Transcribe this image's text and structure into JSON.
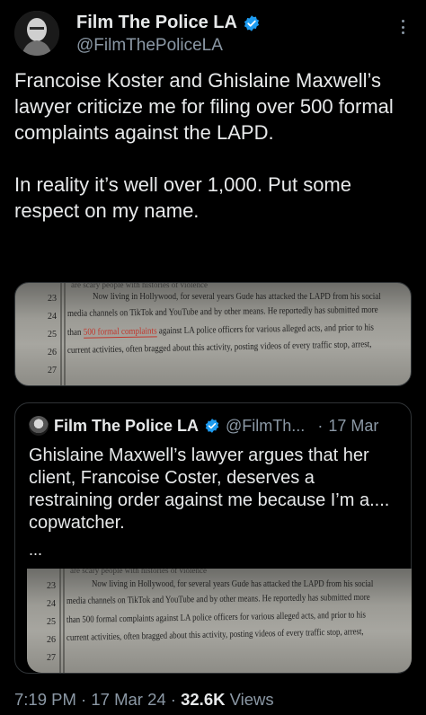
{
  "author": {
    "display_name": "Film The Police LA",
    "handle": "@FilmThePoliceLA"
  },
  "tweet": {
    "text": "Francoise Koster and Ghislaine Maxwell’s lawyer criticize me for filing over 500 formal complaints against the LAPD.\n\nIn reality it’s well over 1,000. Put some respect on my name."
  },
  "document_image": {
    "top_cut_text": "are scary people with histories of violence",
    "line_numbers": [
      "23",
      "24",
      "25",
      "26",
      "27"
    ],
    "lines": [
      "Now living in Hollywood, for several years Gude has attacked the LAPD from his social",
      "media channels on TikTok and YouTube and by other means. He reportedly has submitted more",
      "than",
      "500 formal complaints",
      "against LA police officers for various alleged acts, and prior to his",
      "current activities, often bragged about this activity, posting videos of every traffic stop, arrest,"
    ],
    "line25_plain": "than 500 formal complaints against LA police officers for various alleged acts, and prior to his"
  },
  "quoted_tweet": {
    "display_name": "Film The Police LA",
    "handle": "@FilmTh...",
    "separator": "·",
    "date": "17 Mar",
    "text": "Ghislaine Maxwell’s lawyer argues that her client, Francoise Coster, deserves a restraining order against me because I’m a.... copwatcher.",
    "ellipsis": "..."
  },
  "meta": {
    "time": "7:19 PM",
    "date": "17 Mar 24",
    "dot": "·",
    "views_count": "32.6K",
    "views_label": "Views"
  },
  "colors": {
    "background": "#000000",
    "text": "#e7e9ea",
    "secondary": "#8b98a5",
    "verified": "#1d9bf0",
    "highlight": "#c2352b"
  },
  "icons": [
    "verified-badge-icon",
    "more-options-icon"
  ]
}
